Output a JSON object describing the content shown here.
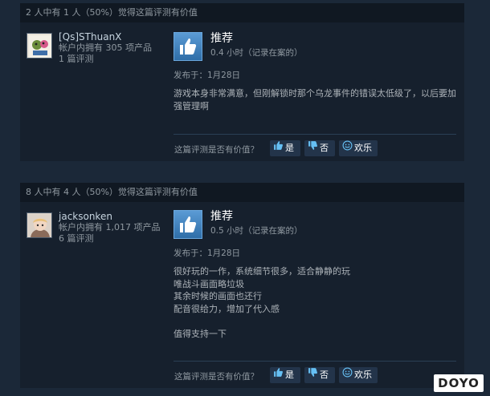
{
  "reviews": [
    {
      "helpful_summary": "2 人中有 1 人（50%）觉得这篇评测有价值",
      "author": {
        "name": "[Qs]SThuanX",
        "products": "帐户内拥有 305 项产品",
        "reviews": "1 篇评测"
      },
      "verdict": "推荐",
      "hours": "0.4 小时（记录在案的）",
      "posted": "发布于：1月28日",
      "text": "游戏本身非常满意，但刚解锁时那个乌龙事件的错误太低级了，以后要加强管理啊",
      "helpful_question": "这篇评测是否有价值？",
      "yes_label": "是",
      "no_label": "否",
      "funny_label": "欢乐"
    },
    {
      "helpful_summary": "8 人中有 4 人（50%）觉得这篇评测有价值",
      "author": {
        "name": "jacksonken",
        "products": "帐户内拥有 1,017 项产品",
        "reviews": "6 篇评测"
      },
      "verdict": "推荐",
      "hours": "0.5 小时（记录在案的）",
      "posted": "发布于：1月28日",
      "text": "很好玩的一作，系统细节很多，适合静静的玩\n唯战斗画面略垃圾\n其余时候的画面也还行\n配音很给力，增加了代入感\n\n值得支持一下",
      "helpful_question": "这篇评测是否有价值？",
      "yes_label": "是",
      "no_label": "否",
      "funny_label": "欢乐"
    }
  ],
  "watermark": "DOYO"
}
